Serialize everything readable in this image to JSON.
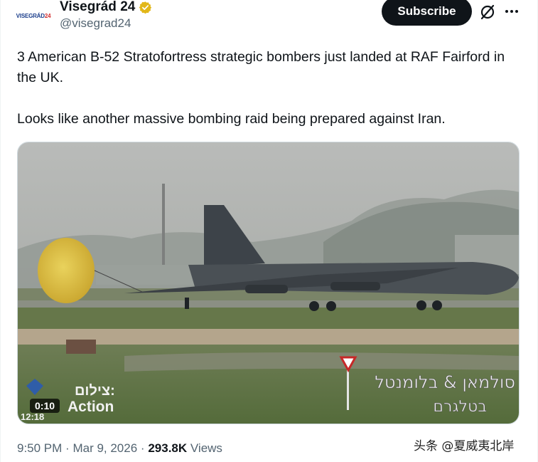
{
  "account": {
    "logo_text_main": "VISEGRÁD",
    "logo_text_num": "24",
    "display_name": "Visegrád 24",
    "handle": "@visegrad24",
    "verified": true,
    "verified_color": "#e2b719"
  },
  "actions": {
    "subscribe_label": "Subscribe",
    "grok_icon": "grok-icon",
    "more_icon": "more-horizontal-icon"
  },
  "tweet": {
    "paragraphs": [
      "3 American B-52 Stratofortress strategic bombers just landed at RAF Fairford in the UK.",
      "Looks like another massive bombing raid being prepared against Iran."
    ]
  },
  "media": {
    "type": "video",
    "duration": "0:10",
    "overlay_credit_top": "צילום:",
    "overlay_credit_bottom": "Action",
    "overlay_time": "12:18",
    "overlay_credit_right_top": "סולמאן & בלומנטל",
    "overlay_credit_right_bottom": "בטלגרם"
  },
  "footer": {
    "time": "9:50 PM",
    "separator": "·",
    "date": "Mar 9, 2026",
    "views_count": "293.8K",
    "views_label": "Views"
  },
  "watermark": "头条 @夏威夷北岸",
  "colors": {
    "text_primary": "#0f1419",
    "text_secondary": "#536471",
    "button_bg": "#0f1419",
    "border": "#cfd9de"
  }
}
